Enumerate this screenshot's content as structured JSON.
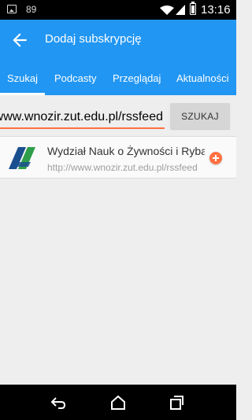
{
  "status_bar": {
    "notification_count": "89",
    "time": "13:16",
    "icons": [
      "image-icon",
      "wifi-icon",
      "signal-icon",
      "battery-icon"
    ]
  },
  "app_bar": {
    "title": "Dodaj subskrypcję",
    "back_icon": "arrow-back-icon"
  },
  "tabs": [
    {
      "label": "Szukaj",
      "active": true
    },
    {
      "label": "Podcasty",
      "active": false
    },
    {
      "label": "Przeglądaj",
      "active": false
    },
    {
      "label": "Aktualności",
      "active": false
    }
  ],
  "search": {
    "value": "http://www.wnozir.zut.edu.pl/rssfeed",
    "button_label": "SZUKAJ"
  },
  "results": [
    {
      "title": "Wydział Nauk o Żywności i Rybactwa",
      "url": "http://www.wnozir.zut.edu.pl/rssfeed",
      "add_icon": "add-circle-icon"
    }
  ],
  "nav_bar": {
    "icons": [
      "back-icon",
      "home-icon",
      "recents-icon"
    ]
  },
  "colors": {
    "primary": "#2196f3",
    "accent": "#ff7043",
    "background": "#eeeeee"
  }
}
